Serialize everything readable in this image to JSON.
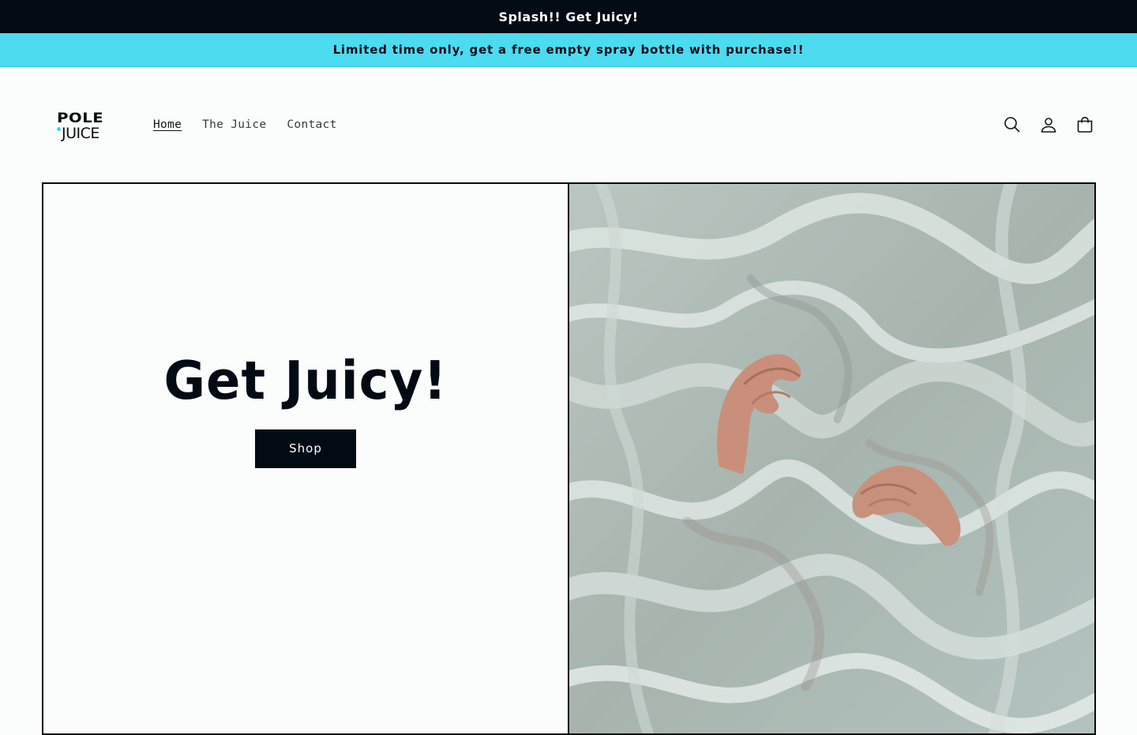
{
  "announcement": {
    "text": "Splash!! Get Juicy!"
  },
  "promo": {
    "text": "Limited time only, get a free empty spray bottle with purchase!!"
  },
  "logo": {
    "line1": "POLE",
    "line2": "JUICE"
  },
  "nav": {
    "items": [
      {
        "label": "Home",
        "active": true
      },
      {
        "label": "The Juice",
        "active": false
      },
      {
        "label": "Contact",
        "active": false
      }
    ]
  },
  "header_icons": [
    "search-icon",
    "account-icon",
    "cart-icon"
  ],
  "hero": {
    "title": "Get Juicy!",
    "button_label": "Shop",
    "image": "hands-in-marbled-liquid"
  },
  "colors": {
    "announcement_bg": "#020a14",
    "promo_bg": "#4ddbf0",
    "button_bg": "#020a14",
    "page_bg": "#fbfcfc"
  }
}
